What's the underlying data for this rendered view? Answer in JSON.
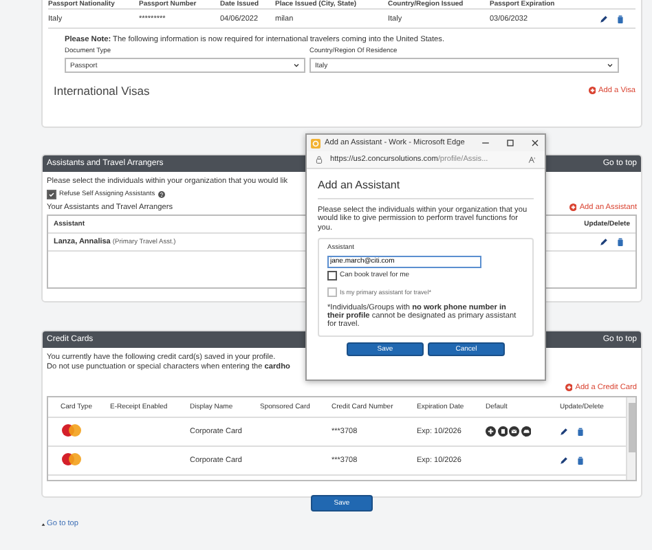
{
  "passport": {
    "columns": [
      "Passport Nationality",
      "Passport Number",
      "Date Issued",
      "Place Issued (City, State)",
      "Country/Region Issued",
      "Passport Expiration"
    ],
    "rows": [
      {
        "cells": [
          "Italy",
          "*********",
          "04/06/2022",
          "milan",
          "Italy",
          "03/06/2032"
        ]
      }
    ],
    "note": "**Please Note:** The following information is now required for international travelers coming into the United States.",
    "fields": [
      {
        "label": "Document Type",
        "value": "Passport"
      },
      {
        "label": "Country/Region Of Residence",
        "value": "Italy"
      }
    ]
  },
  "visas": {
    "title": "International Visas",
    "add_link": "Add a Visa"
  },
  "assistants": {
    "title": "Assistants and Travel Arrangers",
    "go_to_top": "Go to top",
    "intro": "Please select the individuals within your organization that you would lik",
    "refuse": {
      "label": "Refuse Self Assigning Assistants",
      "checked": true
    },
    "subtitle": "Your Assistants and Travel Arrangers",
    "add_link": "Add an Assistant",
    "columns": [
      "Assistant",
      "Update/Delete"
    ],
    "rows": [
      {
        "name": "Lanza, Annalisa",
        "role": "(Primary Travel Asst.)"
      }
    ]
  },
  "credit_cards": {
    "title": "Credit Cards",
    "go_to_top": "Go to top",
    "lines": [
      "You currently have the following credit card(s) saved in your profile.",
      "Do not use punctuation or special characters when entering the **cardho**"
    ],
    "add_link": "Add a Credit Card",
    "columns": [
      "Card Type",
      "E-Receipt Enabled",
      "Display Name",
      "Sponsored Card",
      "Credit Card Number",
      "Expiration Date",
      "Default",
      "Update/Delete"
    ],
    "rows": [
      {
        "kind": "mastercard",
        "display_name": "Corporate Card",
        "number": "***3708",
        "expiration": "Exp: 10/2026",
        "default_actions": true
      },
      {
        "kind": "mastercard",
        "display_name": "Corporate Card",
        "number": "***3708",
        "expiration": "Exp: 10/2026",
        "default_actions": false
      }
    ]
  },
  "save_button": "Save",
  "go_to_top": "Go to top",
  "popup": {
    "window_title": "Add an Assistant - Work - Microsoft Edge",
    "url_host": "https://us2.concursolutions.com",
    "url_path": "/profile/Assis...",
    "heading": "Add an Assistant",
    "intro": "Please select the individuals within your organization that you would like to give permission to perform travel functions for you.",
    "field_label": "Assistant",
    "field_value": "jane.march@citi.com",
    "options": [
      {
        "label": "Can book travel for me",
        "checked": false,
        "disabled": false
      },
      {
        "label": "Is my primary assistant for travel*",
        "checked": false,
        "disabled": true
      }
    ],
    "footnote": "*Individuals/Groups with **no work phone number in their profile** cannot be designated as primary assistant for travel.",
    "buttons": [
      "Save",
      "Cancel"
    ]
  }
}
